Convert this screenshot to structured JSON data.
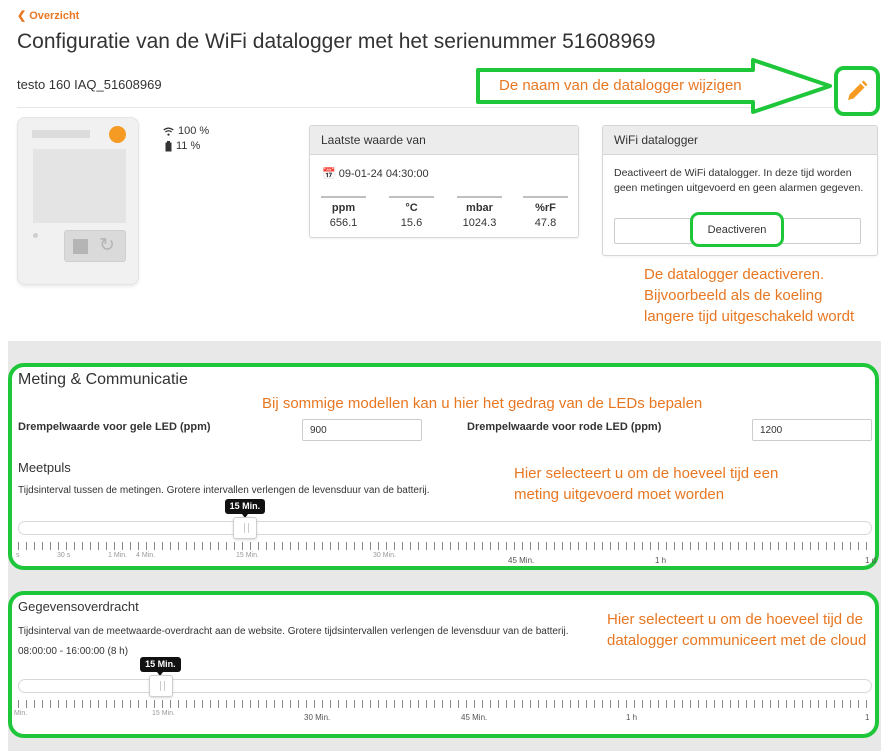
{
  "nav": {
    "back_label": "Overzicht"
  },
  "page": {
    "title": "Configuratie van de WiFi datalogger met het serienummer 51608969",
    "device_name": "testo 160 IAQ_51608969"
  },
  "annotations": {
    "rename": "De naam van de datalogger wijzigen",
    "deactivate": "De datalogger deactiveren. Bijvoorbeeld als de koeling langere tijd uitgeschakeld wordt",
    "leds": "Bij sommige modellen kan u hier het gedrag van de LEDs bepalen",
    "meetpuls": "Hier selecteert u om de hoeveel tijd een meting uitgevoerd moet worden",
    "transfer": "Hier selecteert u om de hoeveel tijd de datalogger communiceert met de cloud"
  },
  "status": {
    "wifi": "100 %",
    "battery": "11 %"
  },
  "last_value": {
    "header": "Laatste waarde van",
    "timestamp": "09-01-24 04:30:00",
    "readings": [
      {
        "unit": "ppm",
        "value": "656.1"
      },
      {
        "unit": "°C",
        "value": "15.6"
      },
      {
        "unit": "mbar",
        "value": "1024.3"
      },
      {
        "unit": "%rF",
        "value": "47.8"
      }
    ]
  },
  "wifi_panel": {
    "header": "WiFi datalogger",
    "text": "Deactiveert de WiFi datalogger. In deze tijd worden geen metingen uitgevoerd en geen alarmen gegeven.",
    "button_label": "Deactiveren"
  },
  "measurement": {
    "title": "Meting & Communicatie",
    "yellow_label": "Drempelwaarde voor gele LED (ppm)",
    "yellow_value": "900",
    "red_label": "Drempelwaarde voor rode LED (ppm)",
    "red_value": "1200",
    "meetpuls_title": "Meetpuls",
    "meetpuls_desc": "Tijdsinterval tussen de metingen. Grotere intervallen verlengen de levensduur van de batterij.",
    "meetpuls_value": "15 Min.",
    "meetpuls_fraction": 0.266,
    "ticks_minor": [
      "s",
      "30 s",
      "1 Min.",
      "4 Min.",
      "15 Min.",
      "30 Min."
    ],
    "ticks_major": [
      "45 Min.",
      "1 h",
      "1 d"
    ]
  },
  "transfer": {
    "title": "Gegevensoverdracht",
    "desc": "Tijdsinterval van de meetwaarde-overdracht aan de website. Grotere tijdsintervallen verlengen de levensduur van de batterij.",
    "window": "08:00:00 - 16:00:00 (8 h)",
    "value": "15 Min.",
    "fraction": 0.167,
    "ticks_minor": [
      "Min.",
      "15 Min."
    ],
    "ticks_major": [
      "30 Min.",
      "45 Min.",
      "1 h",
      "1"
    ]
  },
  "colors": {
    "accent": "#e87722",
    "highlight": "#1ec63a"
  }
}
